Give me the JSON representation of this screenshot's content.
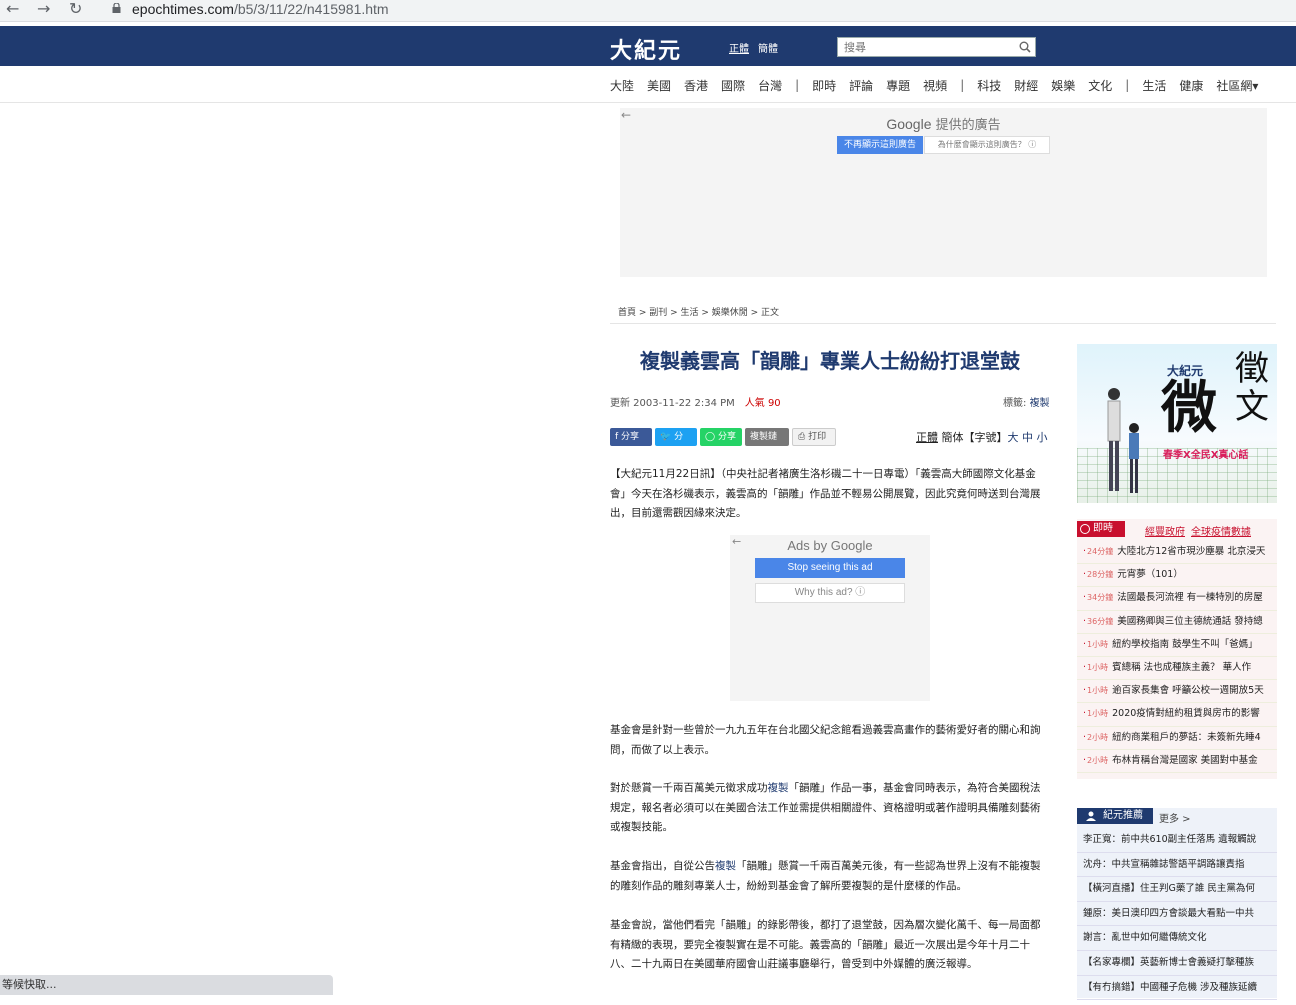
{
  "browser": {
    "url_host": "epochtimes.com",
    "url_path": "/b5/3/11/22/n415981.htm",
    "back_icon": "←",
    "forward_icon": "→",
    "reload_icon": "↻"
  },
  "header": {
    "logo": "大紀元",
    "lang_trad": "正體",
    "lang_simp": "簡體",
    "search_placeholder": "搜尋"
  },
  "menu": {
    "items": [
      "大陸",
      "美國",
      "香港",
      "國際",
      "台灣",
      "|",
      "即時",
      "評論",
      "專題",
      "視頻",
      "|",
      "科技",
      "財經",
      "娛樂",
      "文化",
      "|",
      "生活",
      "健康",
      "社區網▾"
    ]
  },
  "ad_top": {
    "provided_google": "Google",
    "provided_text": " 提供的廣告",
    "btn_stop": "不再顯示這則廣告",
    "btn_why": "為什麼會顯示這則廣告？ ⓘ"
  },
  "breadcrumb": "首頁 > 副刊 > 生活 > 娛樂休閒 > 正文",
  "article": {
    "title": "複製義雲高「韻雕」專業人士紛紛打退堂鼓",
    "updated": "更新 2003-11-22 2:34 PM",
    "views": "人氣 90",
    "tags_label": "標籤: ",
    "tag": "複製",
    "share_fb": "分享",
    "share_tw": "分享",
    "share_wa": "分享",
    "copy_link": "複製鏈接",
    "print": "打印",
    "font_trad": "正體",
    "font_simp": " 簡体【字號】",
    "font_sizes": "大 中 小",
    "p1": "【大紀元11月22日訊】（中央社記者褚廣生洛杉磯二十一日專電）「義雲高大師國際文化基金會」今天在洛杉磯表示，義雲高的「韻雕」作品並不輕易公開展覽，因此究竟何時送到台灣展出，目前還需觀因緣來決定。",
    "p2": "基金會是針對一些曾於一九九五年在台北國父紀念館看過義雲高畫作的藝術愛好者的關心和詢問，而做了以上表示。",
    "p3_a": "對於懸賞一千兩百萬美元徵求成功",
    "p3_link": "複製",
    "p3_b": "「韻雕」作品一事，基金會同時表示，為符合美國稅法規定，報名者必須可以在美國合法工作並需提供相關證件、資格證明或著作證明具備雕刻藝術或複製技能。",
    "p4_a": "基金會指出，自從公告",
    "p4_link": "複製",
    "p4_b": "「韻雕」懸賞一千兩百萬美元後，有一些認為世界上沒有不能複製的雕刻作品的雕刻專業人士，紛紛到基金會了解所要複製的是什麼樣的作品。",
    "p5": "基金會說，當他們看完「韻雕」的錄影帶後，都打了退堂鼓，因為層次變化萬千、每一局面都有精緻的表現，要完全複製實在是不可能。義雲高的「韻雕」最近一次展出是今年十月二十八、二十九兩日在美國華府國會山莊議事廳舉行，曾受到中外媒體的廣泛報導。"
  },
  "ad_inline": {
    "ads_by": "Ads by Google",
    "stop": "Stop seeing this ad",
    "why": "Why this ad? ⓘ"
  },
  "promo": {
    "logo": "大紀元",
    "big": "微",
    "vert": "徵文",
    "slogan": "春季X全民X真心話"
  },
  "news": {
    "tab": "即時",
    "link1": "經豐政府",
    "link2": "全球疫情數據",
    "items": [
      {
        "time": "24分鐘",
        "text": "大陸北方12省市現沙塵暴 北京浸天"
      },
      {
        "time": "28分鐘",
        "text": "元宵夢（101）"
      },
      {
        "time": "34分鐘",
        "text": "法國最長河流裡 有一棟特別的房屋"
      },
      {
        "time": "36分鐘",
        "text": "美國務卿與三位主德統通話 發持總"
      },
      {
        "time": "1小時",
        "text": "紐約學校指南 鼓學生不叫「爸媽」"
      },
      {
        "time": "1小時",
        "text": "賓總稱 法也成種族主義？ 華人作"
      },
      {
        "time": "1小時",
        "text": "逾百家長集會 呼籲公校一週開放5天"
      },
      {
        "time": "1小時",
        "text": "2020疫情對紐約租賃與房市的影響"
      },
      {
        "time": "2小時",
        "text": "紐約商業租戶的夢話：未簽新先睡4"
      },
      {
        "time": "2小時",
        "text": "布林肯稱台灣是國家 美國對中基金"
      }
    ]
  },
  "recommend": {
    "tab": "紀元推薦",
    "more": "更多 >",
    "items": [
      "李正寬：前中共610副主任落馬 遺報觸說",
      "沈舟：中共宣稱雜誌警語平調路讓責指",
      "【橫河直播】住王判G藥了誰 民主黨為何",
      "鍾原：美日澳印四方會談最大看點一中共",
      "謝言：亂世中如何繼傳統文化",
      "【名家專欄】英藝新博士會義疑打擊種族",
      "【有冇搞錯】中國種子危機 涉及種族延續"
    ]
  },
  "status_text": "等候快取..."
}
